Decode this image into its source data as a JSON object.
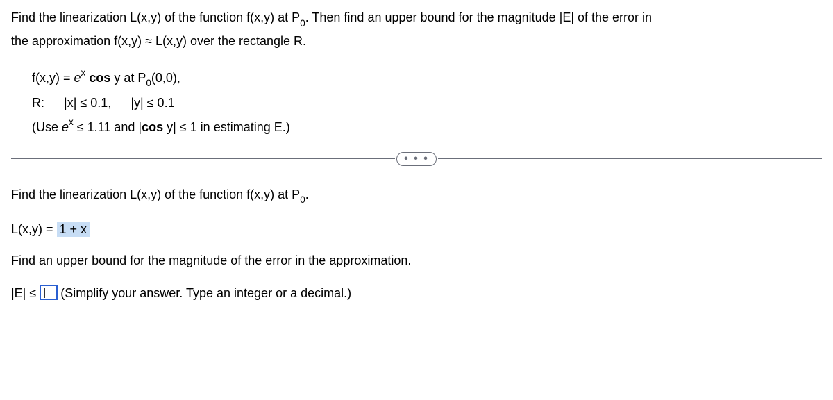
{
  "intro": {
    "line1_a": "Find the linearization L(x,y) of the function f(x,y) at P",
    "line1_sub": "0",
    "line1_b": ". Then find an upper bound for the magnitude |E| of the error in",
    "line2": "the approximation f(x,y) ≈ L(x,y) over the rectangle R."
  },
  "problem": {
    "fn_a": "f(x,y) = ",
    "fn_e": "e",
    "fn_exp": "x",
    "fn_cos": " cos",
    "fn_b": " y at P",
    "fn_sub": "0",
    "fn_c": "(0,0),",
    "r_label": "R:",
    "r_a": "|x| ≤ 0.1,",
    "r_b": "|y| ≤ 0.1",
    "use_a": "(Use ",
    "use_e": "e",
    "use_exp": "x",
    "use_b": " ≤ 1.11 and |",
    "use_cos": "cos",
    "use_c": " y| ≤ 1 in estimating E.)"
  },
  "dots": "• • •",
  "q1": {
    "text_a": "Find the linearization L(x,y) of the function f(x,y) at P",
    "sub": "0",
    "text_b": "."
  },
  "a1": {
    "lhs": "L(x,y) = ",
    "val": "1 + x"
  },
  "q2": {
    "text": "Find an upper bound for the magnitude of the error in the approximation."
  },
  "a2": {
    "lhs": "|E| ≤ ",
    "help": "(Simplify your answer. Type an integer or a decimal.)"
  }
}
